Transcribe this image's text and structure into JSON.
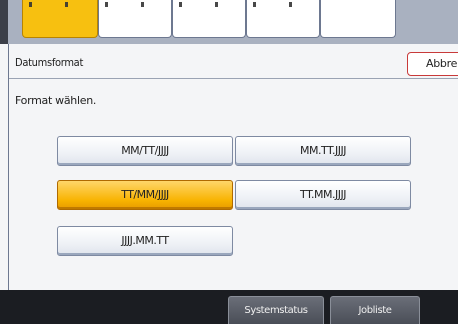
{
  "header": {
    "title": "Datumsformat",
    "cancel_label": "Abbre"
  },
  "instruction": "Format wählen.",
  "formats": [
    {
      "label": "MM/TT/JJJJ",
      "selected": false
    },
    {
      "label": "MM.TT.JJJJ",
      "selected": false
    },
    {
      "label": "TT/MM/JJJJ",
      "selected": true
    },
    {
      "label": "TT.MM.JJJJ",
      "selected": false
    },
    {
      "label": "JJJJ.MM.TT",
      "selected": false
    }
  ],
  "footer": {
    "system_status_label": "Systemstatus",
    "job_list_label": "Jobliste"
  },
  "colors": {
    "accent_selected": "#f8b300",
    "cancel_border": "#c83a3a",
    "tab_active": "#f7c010"
  }
}
